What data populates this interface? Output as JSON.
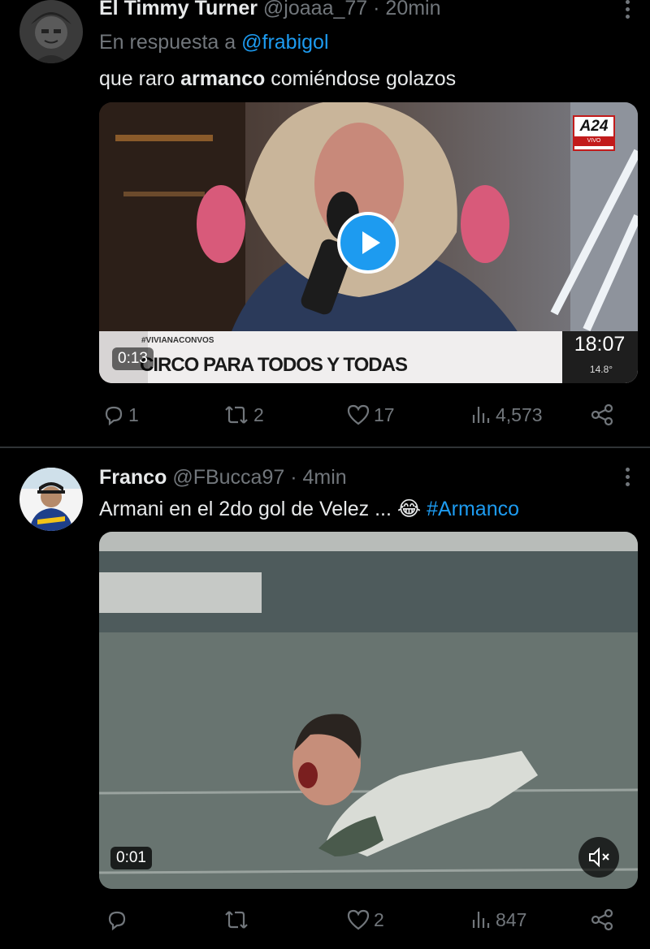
{
  "tweets": [
    {
      "name": "El Timmy Turner",
      "handle": "@joaaa_77",
      "separator": "·",
      "time": "20min",
      "reply_prefix": "En respuesta a",
      "reply_handle": "@frabigol",
      "text_before": "que raro ",
      "text_bold": "armanco",
      "text_after": " comiéndose golazos",
      "video": {
        "channel": "A24",
        "channel_sub": "VIVO",
        "hashtag": "#VIVIANACONVOS",
        "headline": "CIRCO PARA TODOS Y TODAS",
        "clock": "18:07",
        "temp": "14.8°",
        "duration": "0:13"
      },
      "stats": {
        "replies": "1",
        "retweets": "2",
        "likes": "17",
        "views": "4,573"
      }
    },
    {
      "name": "Franco",
      "handle": "@FBucca97",
      "separator": "·",
      "time": "4min",
      "text_before": "Armani en el 2do gol de Velez ... ",
      "emoji": "😂",
      "hashtag": "#Armanco",
      "video": {
        "duration": "0:01"
      },
      "stats": {
        "replies": "",
        "retweets": "",
        "likes": "2",
        "views": "847"
      }
    }
  ],
  "colors": {
    "background": "#000000",
    "text": "#e7e9ea",
    "muted": "#71767b",
    "accent": "#1d9bf0"
  },
  "icons": [
    "reply-icon",
    "retweet-icon",
    "like-icon",
    "views-icon",
    "share-icon",
    "play-icon",
    "mute-icon",
    "more-icon"
  ]
}
